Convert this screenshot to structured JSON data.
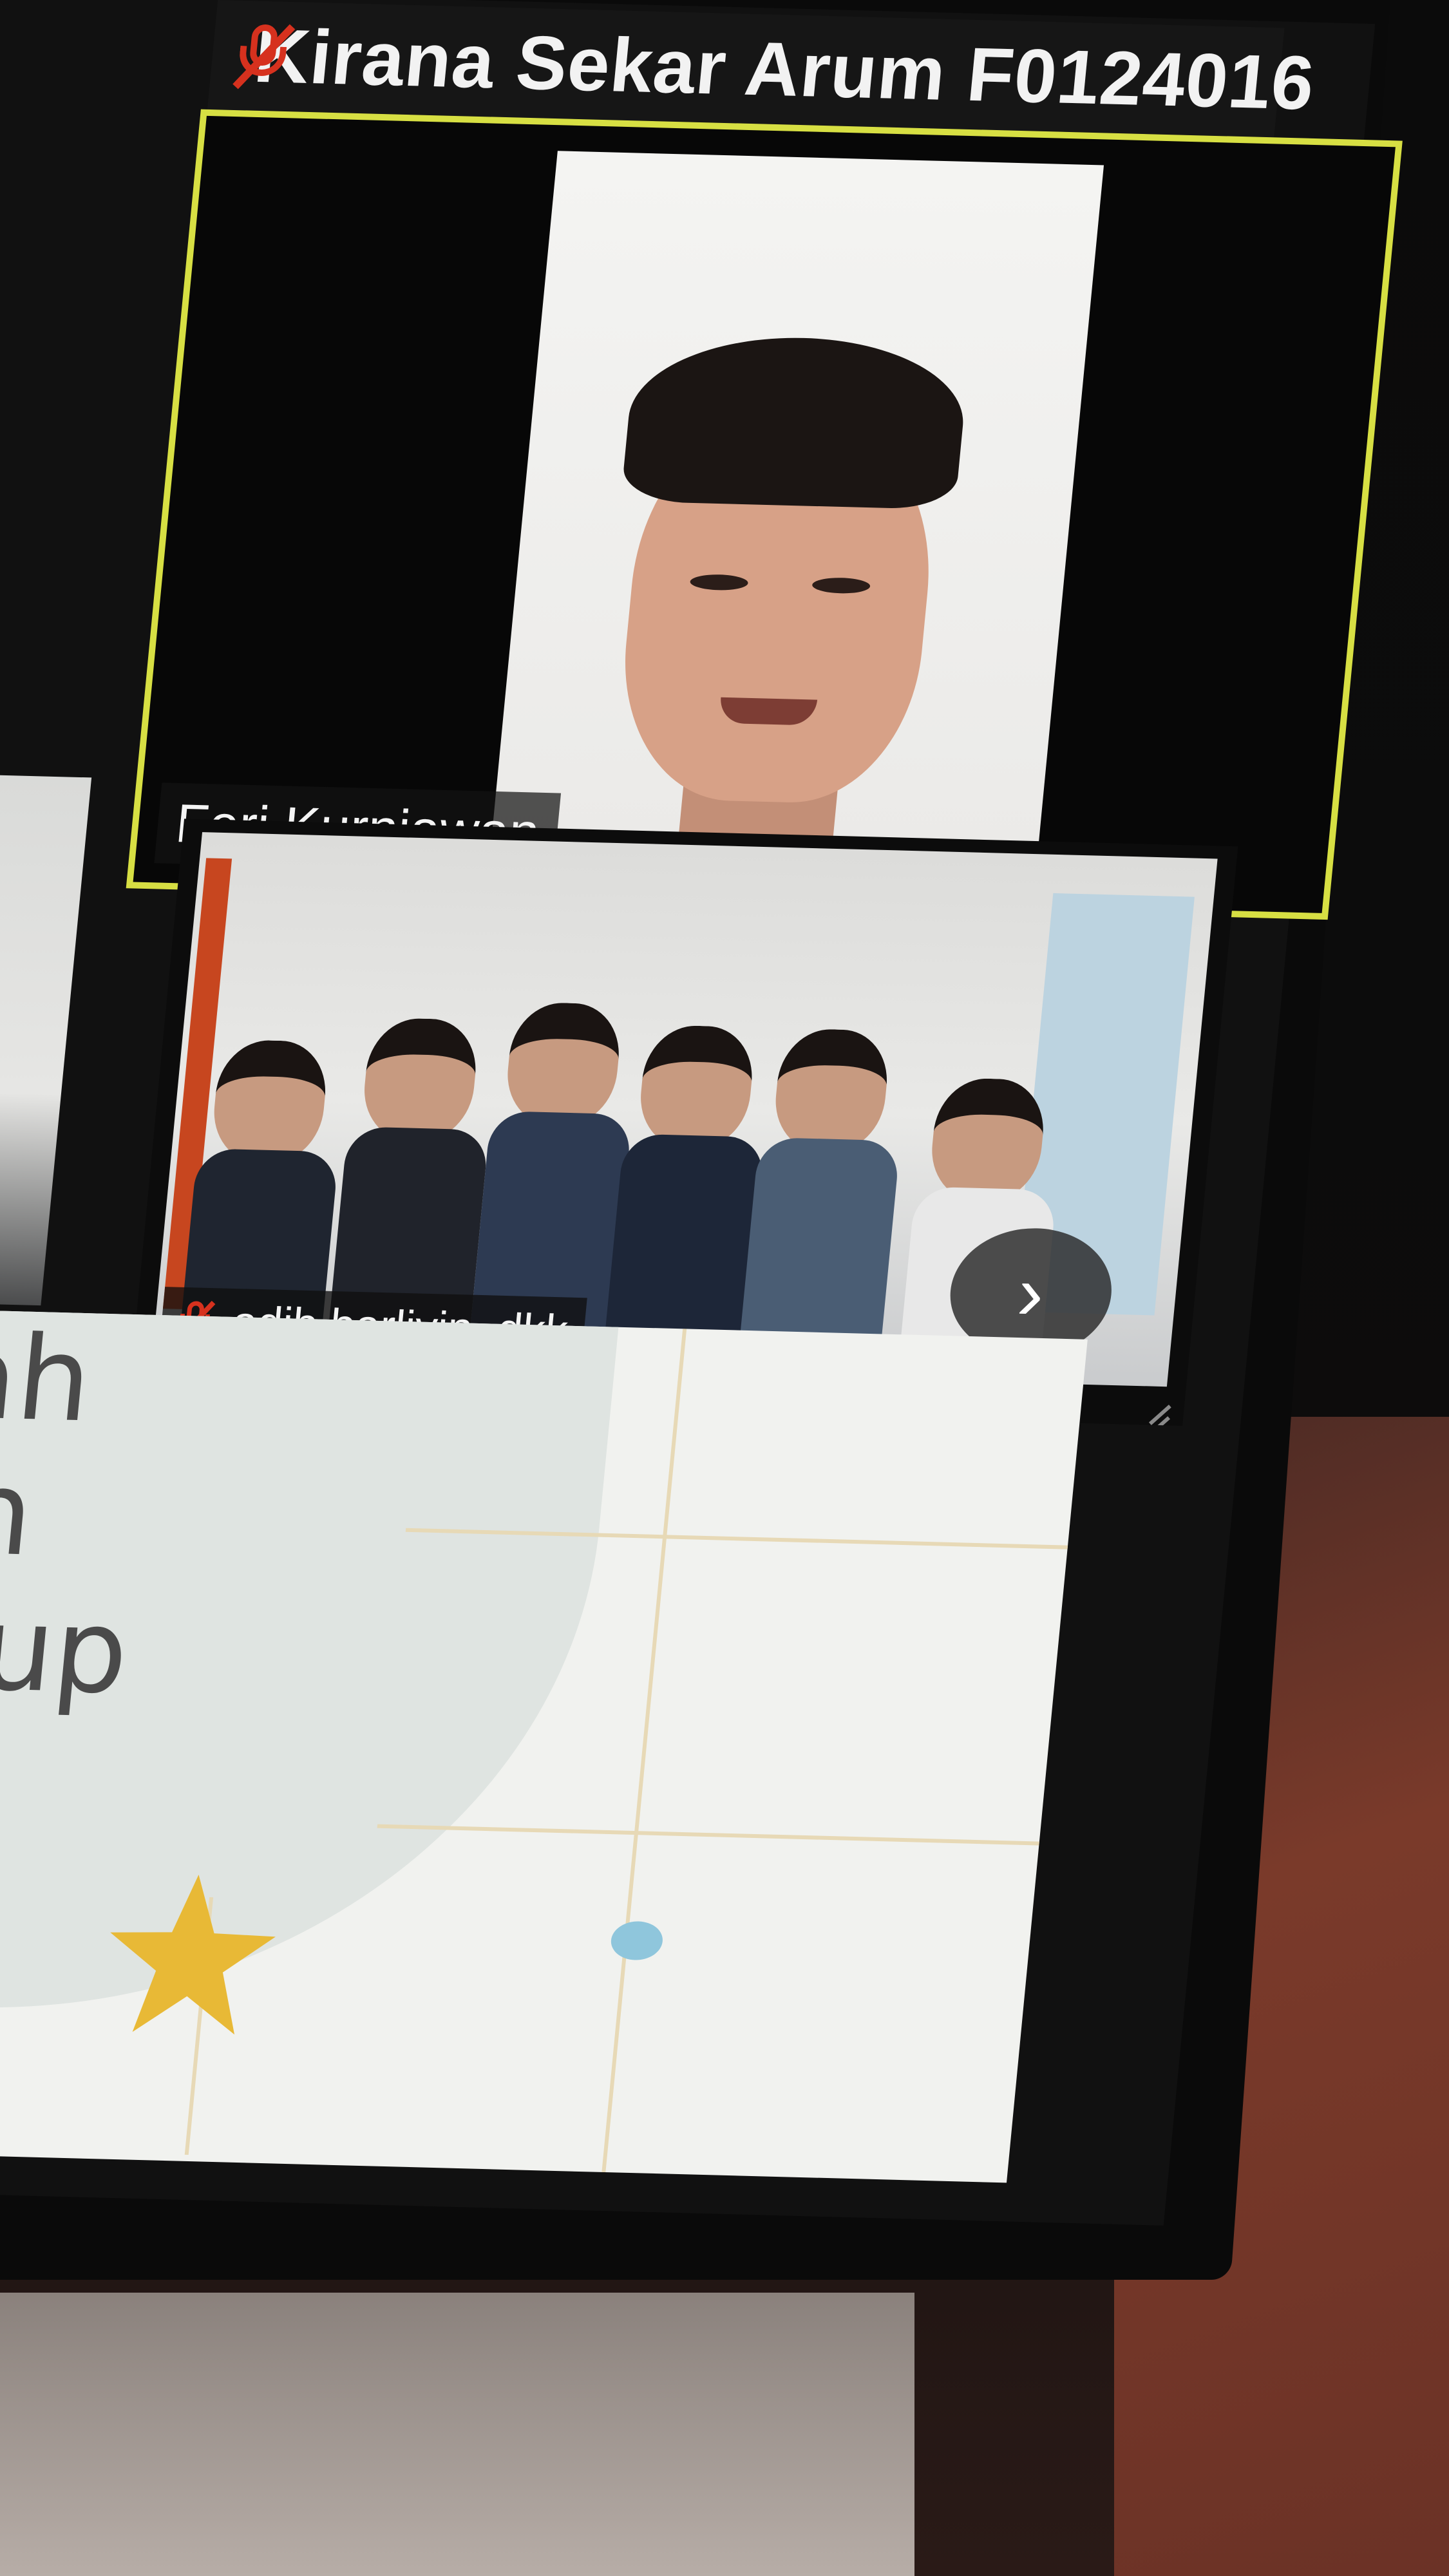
{
  "meeting": {
    "top_participant": {
      "name": "Kirana Sekar Arum F0124016",
      "mic_state": "muted"
    },
    "active_speaker": {
      "name": "Feri Kurniawan"
    },
    "group_participant": {
      "name": "adib barliyin, dkk",
      "mic_state": "muted"
    },
    "next_page_icon": "chevron-right-icon",
    "next_page_glyph": "›"
  },
  "slide": {
    "lines": [
      "ntah",
      "dan",
      "hidup"
    ]
  },
  "colors": {
    "active_border": "#d7df43",
    "muted_red": "#d6311e",
    "star_yellow": "#e8b936",
    "dot_pink": "#e8a4ac",
    "dot_blue": "#8fc6dc"
  }
}
